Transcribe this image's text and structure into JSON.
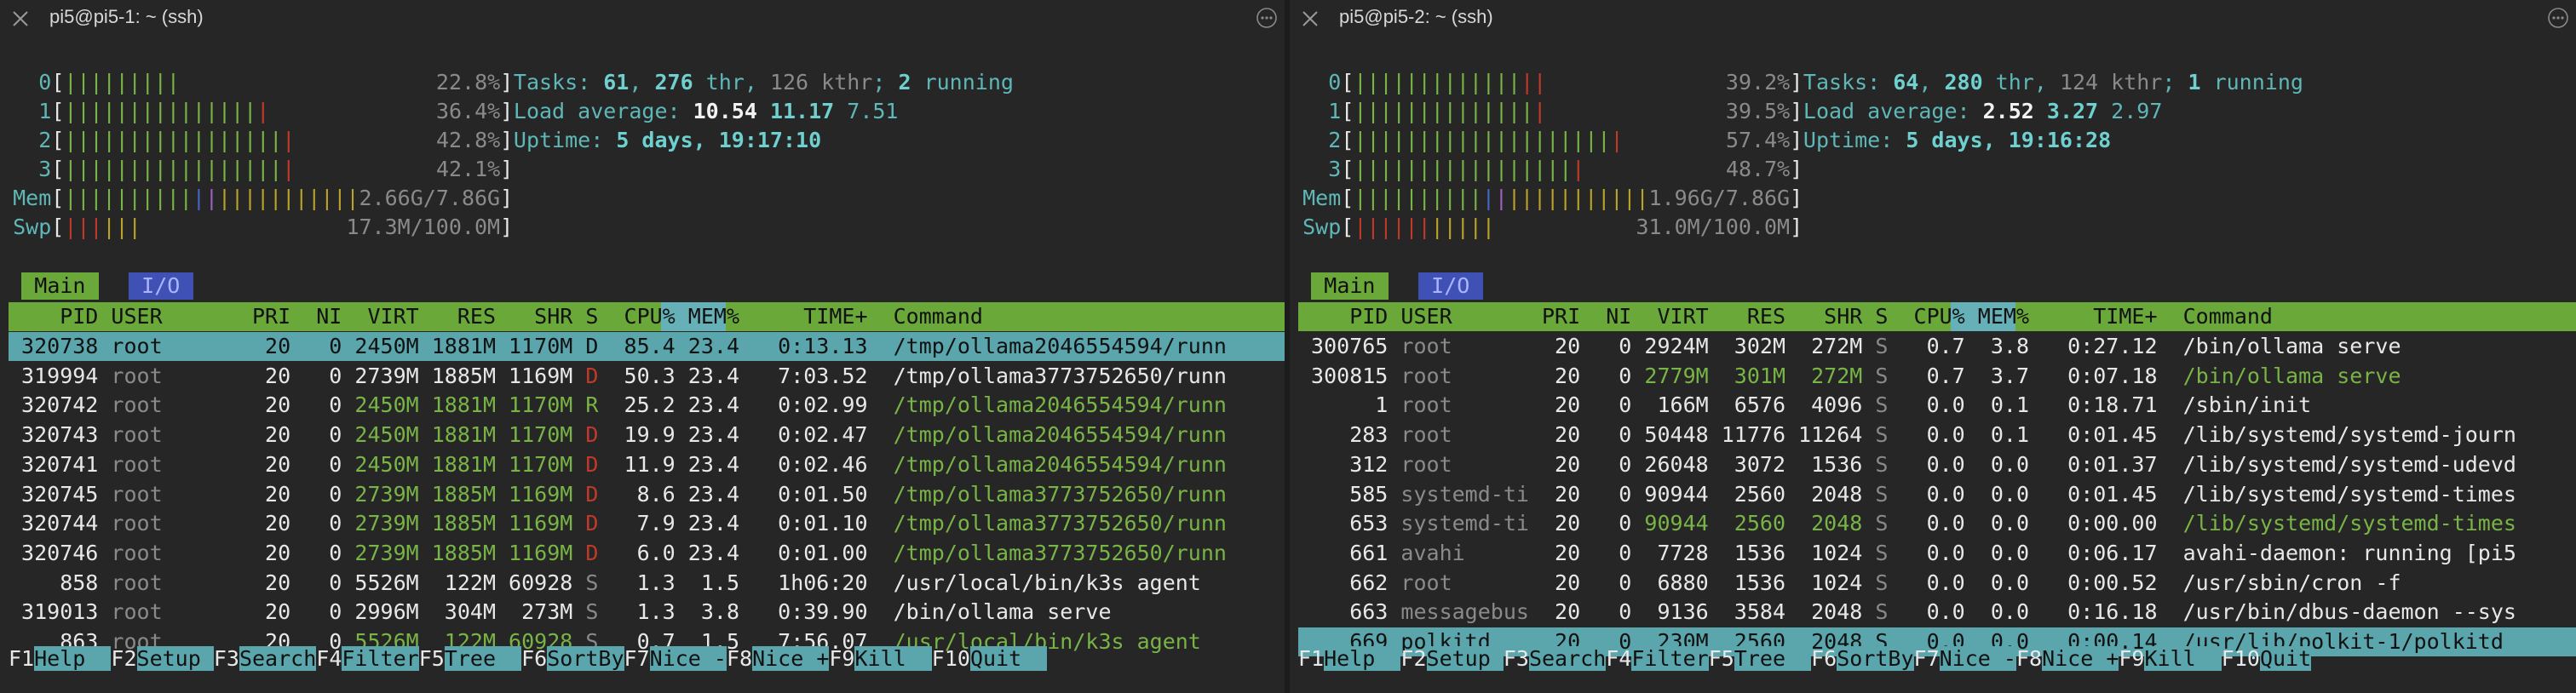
{
  "left": {
    "title": "pi5@pi5-1: ~ (ssh)",
    "cpus": [
      {
        "id": "0",
        "green": 9,
        "red": 0,
        "pct": "22.8%"
      },
      {
        "id": "1",
        "green": 15,
        "red": 1,
        "pct": "36.4%"
      },
      {
        "id": "2",
        "green": 17,
        "red": 1,
        "pct": "42.8%"
      },
      {
        "id": "3",
        "green": 17,
        "red": 1,
        "pct": "42.1%"
      }
    ],
    "mem": {
      "label": "Mem",
      "value": "2.66G/7.86G"
    },
    "swp": {
      "label": "Swp",
      "value": "17.3M/100.0M"
    },
    "tasks": {
      "prefix": "Tasks: ",
      "n": "61",
      "sep": ", ",
      "thr": "276",
      "thr_label": " thr, ",
      "kthr": "126 kthr",
      "sep2": "; ",
      "running": "2",
      "running_label": " running"
    },
    "load": {
      "label": "Load average: ",
      "a": "10.54",
      "b": "11.17",
      "c": "7.51"
    },
    "uptime": {
      "label": "Uptime: ",
      "value": "5 days, 19:17:10"
    },
    "tabs": {
      "main": "Main",
      "io": "I/O"
    },
    "header": {
      "pid": "PID",
      "user": "USER",
      "pri": "PRI",
      "ni": "NI",
      "virt": "VIRT",
      "res": "RES",
      "shr": "SHR",
      "s": "S",
      "cpu": "CPU%",
      "mem": "MEM%",
      "time": "TIME+",
      "cmd": "Command"
    },
    "rows": [
      {
        "pid": "320738",
        "user": "root",
        "pri": "20",
        "ni": "0",
        "virt": "2450M",
        "res": "1881M",
        "shr": "1170M",
        "s": "D",
        "cpu": "85.4",
        "mem": "23.4",
        "time": "0:13.13",
        "cmd": "/tmp/ollama2046554594/runn",
        "sel": true,
        "thread": false
      },
      {
        "pid": "319994",
        "user": "root",
        "pri": "20",
        "ni": "0",
        "virt": "2739M",
        "res": "1885M",
        "shr": "1169M",
        "s": "D",
        "cpu": "50.3",
        "mem": "23.4",
        "time": "7:03.52",
        "cmd": "/tmp/ollama3773752650/runn",
        "sel": false,
        "thread": false
      },
      {
        "pid": "320742",
        "user": "root",
        "pri": "20",
        "ni": "0",
        "virt": "2450M",
        "res": "1881M",
        "shr": "1170M",
        "s": "R",
        "cpu": "25.2",
        "mem": "23.4",
        "time": "0:02.99",
        "cmd": "/tmp/ollama2046554594/runn",
        "sel": false,
        "thread": true
      },
      {
        "pid": "320743",
        "user": "root",
        "pri": "20",
        "ni": "0",
        "virt": "2450M",
        "res": "1881M",
        "shr": "1170M",
        "s": "D",
        "cpu": "19.9",
        "mem": "23.4",
        "time": "0:02.47",
        "cmd": "/tmp/ollama2046554594/runn",
        "sel": false,
        "thread": true
      },
      {
        "pid": "320741",
        "user": "root",
        "pri": "20",
        "ni": "0",
        "virt": "2450M",
        "res": "1881M",
        "shr": "1170M",
        "s": "D",
        "cpu": "11.9",
        "mem": "23.4",
        "time": "0:02.46",
        "cmd": "/tmp/ollama2046554594/runn",
        "sel": false,
        "thread": true
      },
      {
        "pid": "320745",
        "user": "root",
        "pri": "20",
        "ni": "0",
        "virt": "2739M",
        "res": "1885M",
        "shr": "1169M",
        "s": "D",
        "cpu": "8.6",
        "mem": "23.4",
        "time": "0:01.50",
        "cmd": "/tmp/ollama3773752650/runn",
        "sel": false,
        "thread": true
      },
      {
        "pid": "320744",
        "user": "root",
        "pri": "20",
        "ni": "0",
        "virt": "2739M",
        "res": "1885M",
        "shr": "1169M",
        "s": "D",
        "cpu": "7.9",
        "mem": "23.4",
        "time": "0:01.10",
        "cmd": "/tmp/ollama3773752650/runn",
        "sel": false,
        "thread": true
      },
      {
        "pid": "320746",
        "user": "root",
        "pri": "20",
        "ni": "0",
        "virt": "2739M",
        "res": "1885M",
        "shr": "1169M",
        "s": "D",
        "cpu": "6.0",
        "mem": "23.4",
        "time": "0:01.00",
        "cmd": "/tmp/ollama3773752650/runn",
        "sel": false,
        "thread": true
      },
      {
        "pid": "858",
        "user": "root",
        "pri": "20",
        "ni": "0",
        "virt": "5526M",
        "res": "122M",
        "shr": "60928",
        "s": "S",
        "cpu": "1.3",
        "mem": "1.5",
        "time": "1h06:20",
        "cmd": "/usr/local/bin/k3s agent",
        "sel": false,
        "thread": false
      },
      {
        "pid": "319013",
        "user": "root",
        "pri": "20",
        "ni": "0",
        "virt": "2996M",
        "res": "304M",
        "shr": "273M",
        "s": "S",
        "cpu": "1.3",
        "mem": "3.8",
        "time": "0:39.90",
        "cmd": "/bin/ollama serve",
        "sel": false,
        "thread": false
      },
      {
        "pid": "863",
        "user": "root",
        "pri": "20",
        "ni": "0",
        "virt": "5526M",
        "res": "122M",
        "shr": "60928",
        "s": "S",
        "cpu": "0.7",
        "mem": "1.5",
        "time": "7:56.07",
        "cmd": "/usr/local/bin/k3s agent",
        "sel": false,
        "thread": true
      }
    ],
    "fkeys": [
      {
        "key": "F1",
        "desc": "Help  "
      },
      {
        "key": "F2",
        "desc": "Setup "
      },
      {
        "key": "F3",
        "desc": "Search"
      },
      {
        "key": "F4",
        "desc": "Filter"
      },
      {
        "key": "F5",
        "desc": "Tree  "
      },
      {
        "key": "F6",
        "desc": "SortBy"
      },
      {
        "key": "F7",
        "desc": "Nice -"
      },
      {
        "key": "F8",
        "desc": "Nice +"
      },
      {
        "key": "F9",
        "desc": "Kill  "
      },
      {
        "key": "F10",
        "desc": "Quit  "
      }
    ]
  },
  "right": {
    "title": "pi5@pi5-2: ~ (ssh)",
    "cpus": [
      {
        "id": "0",
        "green": 13,
        "red": 2,
        "pct": "39.2%"
      },
      {
        "id": "1",
        "green": 14,
        "red": 1,
        "pct": "39.5%"
      },
      {
        "id": "2",
        "green": 20,
        "red": 1,
        "pct": "57.4%"
      },
      {
        "id": "3",
        "green": 17,
        "red": 1,
        "pct": "48.7%"
      }
    ],
    "mem": {
      "label": "Mem",
      "value": "1.96G/7.86G"
    },
    "swp": {
      "label": "Swp",
      "value": "31.0M/100.0M"
    },
    "tasks": {
      "prefix": "Tasks: ",
      "n": "64",
      "sep": ", ",
      "thr": "280",
      "thr_label": " thr, ",
      "kthr": "124 kthr",
      "sep2": "; ",
      "running": "1",
      "running_label": " running"
    },
    "load": {
      "label": "Load average: ",
      "a": "2.52",
      "b": "3.27",
      "c": "2.97"
    },
    "uptime": {
      "label": "Uptime: ",
      "value": "5 days, 19:16:28"
    },
    "tabs": {
      "main": "Main",
      "io": "I/O"
    },
    "header": {
      "pid": "PID",
      "user": "USER",
      "pri": "PRI",
      "ni": "NI",
      "virt": "VIRT",
      "res": "RES",
      "shr": "SHR",
      "s": "S",
      "cpu": "CPU%",
      "mem": "MEM%",
      "time": "TIME+",
      "cmd": "Command"
    },
    "rows": [
      {
        "pid": "300765",
        "user": "root",
        "pri": "20",
        "ni": "0",
        "virt": "2924M",
        "res": "302M",
        "shr": "272M",
        "s": "S",
        "cpu": "0.7",
        "mem": "3.8",
        "time": "0:27.12",
        "cmd": "/bin/ollama serve",
        "sel": false,
        "thread": false
      },
      {
        "pid": "300815",
        "user": "root",
        "pri": "20",
        "ni": "0",
        "virt": "2779M",
        "res": "301M",
        "shr": "272M",
        "s": "S",
        "cpu": "0.7",
        "mem": "3.7",
        "time": "0:07.18",
        "cmd": "/bin/ollama serve",
        "sel": false,
        "thread": true
      },
      {
        "pid": "1",
        "user": "root",
        "pri": "20",
        "ni": "0",
        "virt": "166M",
        "res": "6576",
        "shr": "4096",
        "s": "S",
        "cpu": "0.0",
        "mem": "0.1",
        "time": "0:18.71",
        "cmd": "/sbin/init",
        "sel": false,
        "thread": false
      },
      {
        "pid": "283",
        "user": "root",
        "pri": "20",
        "ni": "0",
        "virt": "50448",
        "res": "11776",
        "shr": "11264",
        "s": "S",
        "cpu": "0.0",
        "mem": "0.1",
        "time": "0:01.45",
        "cmd": "/lib/systemd/systemd-journ",
        "sel": false,
        "thread": false
      },
      {
        "pid": "312",
        "user": "root",
        "pri": "20",
        "ni": "0",
        "virt": "26048",
        "res": "3072",
        "shr": "1536",
        "s": "S",
        "cpu": "0.0",
        "mem": "0.0",
        "time": "0:01.37",
        "cmd": "/lib/systemd/systemd-udevd",
        "sel": false,
        "thread": false
      },
      {
        "pid": "585",
        "user": "systemd-ti",
        "pri": "20",
        "ni": "0",
        "virt": "90944",
        "res": "2560",
        "shr": "2048",
        "s": "S",
        "cpu": "0.0",
        "mem": "0.0",
        "time": "0:01.45",
        "cmd": "/lib/systemd/systemd-times",
        "sel": false,
        "thread": false
      },
      {
        "pid": "653",
        "user": "systemd-ti",
        "pri": "20",
        "ni": "0",
        "virt": "90944",
        "res": "2560",
        "shr": "2048",
        "s": "S",
        "cpu": "0.0",
        "mem": "0.0",
        "time": "0:00.00",
        "cmd": "/lib/systemd/systemd-times",
        "sel": false,
        "thread": true
      },
      {
        "pid": "661",
        "user": "avahi",
        "pri": "20",
        "ni": "0",
        "virt": "7728",
        "res": "1536",
        "shr": "1024",
        "s": "S",
        "cpu": "0.0",
        "mem": "0.0",
        "time": "0:06.17",
        "cmd": "avahi-daemon: running [pi5",
        "sel": false,
        "thread": false
      },
      {
        "pid": "662",
        "user": "root",
        "pri": "20",
        "ni": "0",
        "virt": "6880",
        "res": "1536",
        "shr": "1024",
        "s": "S",
        "cpu": "0.0",
        "mem": "0.0",
        "time": "0:00.52",
        "cmd": "/usr/sbin/cron -f",
        "sel": false,
        "thread": false
      },
      {
        "pid": "663",
        "user": "messagebus",
        "pri": "20",
        "ni": "0",
        "virt": "9136",
        "res": "3584",
        "shr": "2048",
        "s": "S",
        "cpu": "0.0",
        "mem": "0.0",
        "time": "0:16.18",
        "cmd": "/usr/bin/dbus-daemon --sys",
        "sel": false,
        "thread": false
      },
      {
        "pid": "669",
        "user": "polkitd",
        "pri": "20",
        "ni": "0",
        "virt": "230M",
        "res": "2560",
        "shr": "2048",
        "s": "S",
        "cpu": "0.0",
        "mem": "0.0",
        "time": "0:00.14",
        "cmd": "/usr/lib/polkit-1/polkitd",
        "sel": true,
        "thread": false
      }
    ],
    "fkeys": [
      {
        "key": "F1",
        "desc": "Help  "
      },
      {
        "key": "F2",
        "desc": "Setup "
      },
      {
        "key": "F3",
        "desc": "Search"
      },
      {
        "key": "F4",
        "desc": "Filter"
      },
      {
        "key": "F5",
        "desc": "Tree  "
      },
      {
        "key": "F6",
        "desc": "SortBy"
      },
      {
        "key": "F7",
        "desc": "Nice -"
      },
      {
        "key": "F8",
        "desc": "Nice +"
      },
      {
        "key": "F9",
        "desc": "Kill  "
      },
      {
        "key": "F10",
        "desc": "Quit"
      }
    ]
  },
  "icons": {
    "close": "close-icon",
    "more": "more-options-icon"
  },
  "colors": {
    "bg": "#262626",
    "header_green": "#6aa83a",
    "selected_row": "#5aa6ac",
    "tab_io_blue": "#3f51b5"
  }
}
